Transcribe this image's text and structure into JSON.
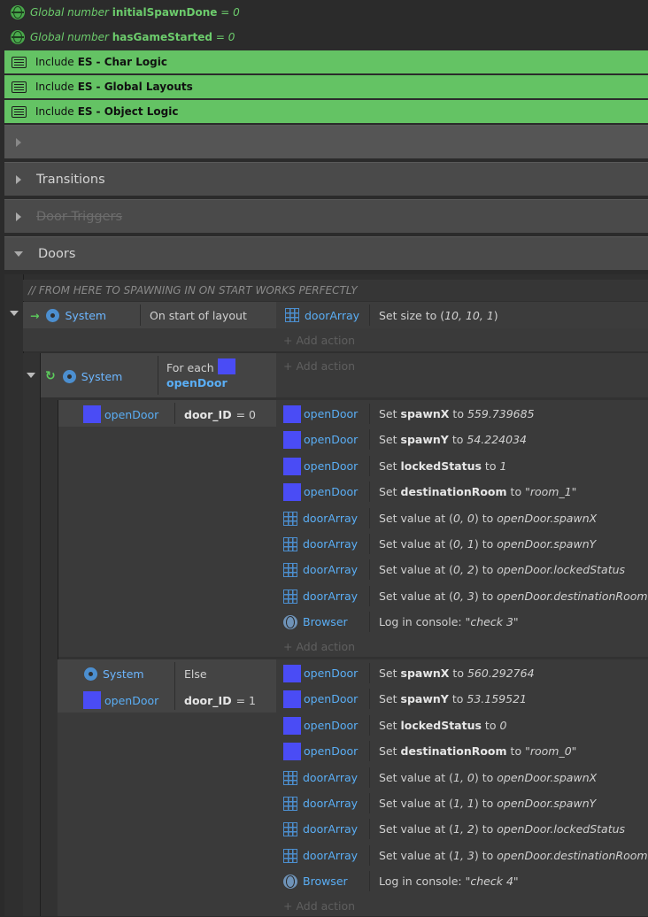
{
  "globals": [
    {
      "prefix": "Global number",
      "name": "initialSpawnDone",
      "suffix": "= 0"
    },
    {
      "prefix": "Global number",
      "name": "hasGameStarted",
      "suffix": "= 0"
    }
  ],
  "includes": [
    {
      "prefix": "Include",
      "es": "ES",
      "rest": "- Char Logic"
    },
    {
      "prefix": "Include",
      "es": "ES",
      "rest": "- Global Layouts"
    },
    {
      "prefix": "Include",
      "es": "ES",
      "rest": "- Object Logic"
    }
  ],
  "groups": {
    "g0": "",
    "g1": "Transitions",
    "g2": "Door Triggers",
    "g3": "Doors"
  },
  "comment": "//  FROM HERE TO SPAWNING IN ON START WORKS PERFECTLY",
  "ev1": {
    "arrow": "→",
    "obj": "System",
    "cond": "On start of layout",
    "action_obj": "doorArray",
    "action_pre": "Set size to (",
    "action_val": "10, 10, 1",
    "action_post": ")",
    "add": "+ Add action"
  },
  "ev2": {
    "obj": "System",
    "cond_pre": "For each",
    "cond_obj": "openDoor",
    "add": "+ Add action"
  },
  "ev3": {
    "obj": "openDoor",
    "cond_var": "door_ID",
    "cond_val": "= 0",
    "actions": [
      {
        "obj": "openDoor",
        "pre": "Set",
        "bold": "spawnX",
        "mid": "to",
        "val": "559.739685"
      },
      {
        "obj": "openDoor",
        "pre": "Set",
        "bold": "spawnY",
        "mid": "to",
        "val": "54.224034"
      },
      {
        "obj": "openDoor",
        "pre": "Set",
        "bold": "lockedStatus",
        "mid": "to",
        "val": "1"
      },
      {
        "obj": "openDoor",
        "pre": "Set",
        "bold": "destinationRoom",
        "mid": "to",
        "val": "\"room_1\""
      },
      {
        "obj": "doorArray",
        "pre": "Set value at (",
        "bold": "",
        "mid": "",
        "val": "0, 0",
        "post": ") to",
        "val2": "openDoor.spawnX"
      },
      {
        "obj": "doorArray",
        "pre": "Set value at (",
        "bold": "",
        "mid": "",
        "val": "0, 1",
        "post": ") to",
        "val2": "openDoor.spawnY"
      },
      {
        "obj": "doorArray",
        "pre": "Set value at (",
        "bold": "",
        "mid": "",
        "val": "0, 2",
        "post": ") to",
        "val2": "openDoor.lockedStatus"
      },
      {
        "obj": "doorArray",
        "pre": "Set value at (",
        "bold": "",
        "mid": "",
        "val": "0, 3",
        "post": ") to",
        "val2": "openDoor.destinationRoom"
      },
      {
        "obj": "Browser",
        "pre": "Log in console:",
        "bold": "",
        "mid": "",
        "val": "\"check 3\""
      }
    ],
    "add": "+ Add action"
  },
  "ev4": {
    "obj1": "System",
    "cond1": "Else",
    "obj2": "openDoor",
    "cond_var": "door_ID",
    "cond_val": "= 1",
    "actions": [
      {
        "obj": "openDoor",
        "pre": "Set",
        "bold": "spawnX",
        "mid": "to",
        "val": "560.292764"
      },
      {
        "obj": "openDoor",
        "pre": "Set",
        "bold": "spawnY",
        "mid": "to",
        "val": "53.159521"
      },
      {
        "obj": "openDoor",
        "pre": "Set",
        "bold": "lockedStatus",
        "mid": "to",
        "val": "0"
      },
      {
        "obj": "openDoor",
        "pre": "Set",
        "bold": "destinationRoom",
        "mid": "to",
        "val": "\"room_0\""
      },
      {
        "obj": "doorArray",
        "pre": "Set value at (",
        "bold": "",
        "mid": "",
        "val": "1, 0",
        "post": ") to",
        "val2": "openDoor.spawnX"
      },
      {
        "obj": "doorArray",
        "pre": "Set value at (",
        "bold": "",
        "mid": "",
        "val": "1, 1",
        "post": ") to",
        "val2": "openDoor.spawnY"
      },
      {
        "obj": "doorArray",
        "pre": "Set value at (",
        "bold": "",
        "mid": "",
        "val": "1, 2",
        "post": ") to",
        "val2": "openDoor.lockedStatus"
      },
      {
        "obj": "doorArray",
        "pre": "Set value at (",
        "bold": "",
        "mid": "",
        "val": "1, 3",
        "post": ") to",
        "val2": "openDoor.destinationRoom"
      },
      {
        "obj": "Browser",
        "pre": "Log in console:",
        "bold": "",
        "mid": "",
        "val": "\"check 4\""
      }
    ],
    "add": "+ Add action"
  },
  "colors": {
    "include_green": "#64c364",
    "global_green": "#6ccc6c",
    "object_blue": "#5aaef5",
    "sprite_color": "#4a4cf5"
  }
}
